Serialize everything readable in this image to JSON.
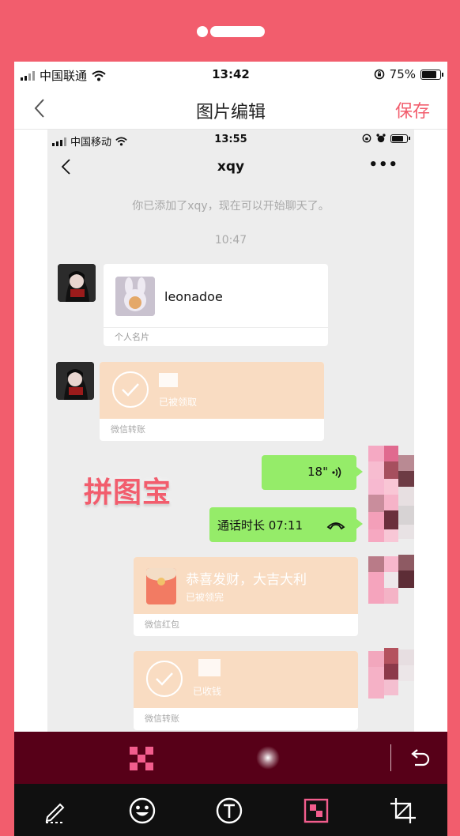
{
  "status": {
    "carrier": "中国联通",
    "time": "13:42",
    "battery": "75%",
    "battery_level": 0.75
  },
  "nav": {
    "title": "图片编辑",
    "save_label": "保存"
  },
  "image": {
    "status": {
      "carrier": "中国移动",
      "time": "13:55"
    },
    "chat_title": "xqy",
    "more": "•••",
    "system_message": "你已添加了xqy，现在可以开始聊天了。",
    "timestamp": "10:47",
    "contact_card": {
      "name": "leonadoe",
      "footer": "个人名片"
    },
    "transfer1": {
      "status": "已被领取",
      "footer": "微信转账"
    },
    "voice": {
      "duration": "18\""
    },
    "call": {
      "text": "通话时长 07:11"
    },
    "red_packet": {
      "title": "恭喜发财，大吉大利",
      "status": "已被领完",
      "footer": "微信红包"
    },
    "transfer2": {
      "status": "已收钱",
      "footer": "微信转账"
    },
    "watermark": "拼图宝"
  },
  "colors": {
    "accent": "#f25d6d",
    "bubble": "#95ec69",
    "transfer": "#f9dcc2",
    "panel": "#570018",
    "toolbar": "#101010"
  },
  "tools": [
    "pen-icon",
    "emoji-icon",
    "text-icon",
    "mosaic-icon",
    "crop-icon"
  ]
}
